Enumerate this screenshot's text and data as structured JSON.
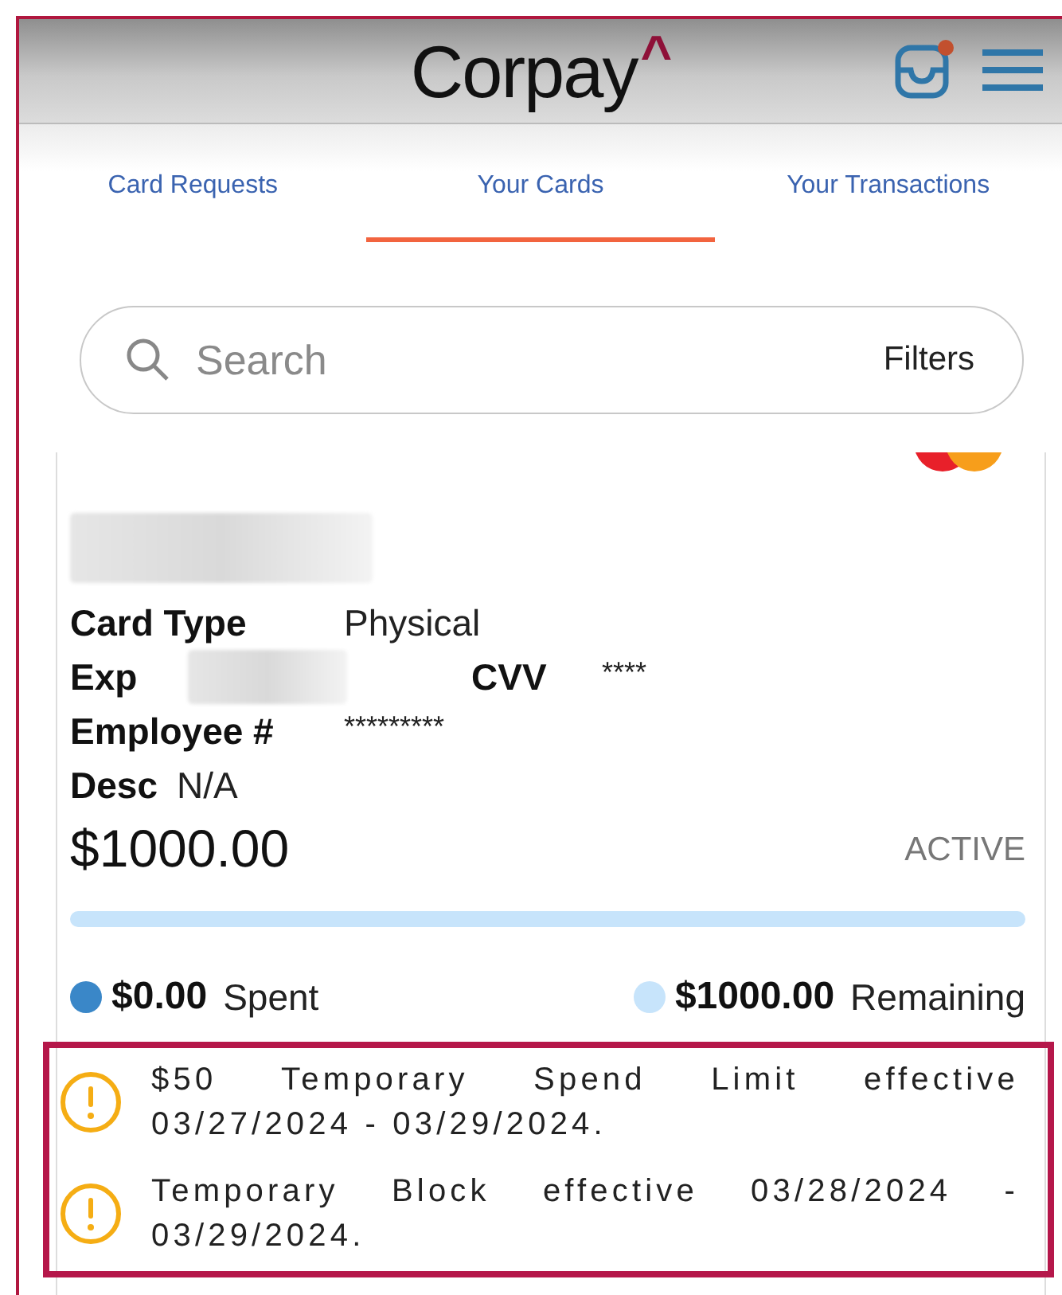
{
  "header": {
    "logo": "Corpay",
    "logo_mark": "^",
    "unread": true
  },
  "tabs": [
    {
      "label": "Card Requests",
      "selected": false
    },
    {
      "label": "Your Cards",
      "selected": true
    },
    {
      "label": "Your Transactions",
      "selected": false
    }
  ],
  "search": {
    "placeholder": "Search",
    "filters": "Filters"
  },
  "card": {
    "card_type": {
      "label": "Card Type",
      "value": "Physical"
    },
    "exp": {
      "label": "Exp",
      "cvv_label": "CVV",
      "cvv_value": "****"
    },
    "employee": {
      "label": "Employee #",
      "value": "*********"
    },
    "desc": {
      "label": "Desc",
      "value": "N/A"
    },
    "limit": "$1000.00",
    "status": "ACTIVE",
    "usage": {
      "level": 0
    },
    "spent": {
      "amount": "$0.00",
      "label": "Spent"
    },
    "remaining": {
      "amount": "$1000.00",
      "label": "Remaining"
    }
  },
  "notices": [
    {
      "text": "$50 Temporary Spend Limit effective 03/27/2024 - 03/29/2024."
    },
    {
      "text": "Temporary Block effective 03/28/2024 - 03/29/2024."
    }
  ]
}
